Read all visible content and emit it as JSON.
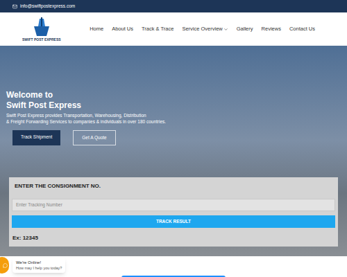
{
  "top_bar": {
    "email": "info@swiftpostexpress.com"
  },
  "logo": {
    "text": "SWIFT POST EXPRESS"
  },
  "nav": [
    {
      "label": "Home",
      "has_menu": false
    },
    {
      "label": "About Us",
      "has_menu": false
    },
    {
      "label": "Track & Trace",
      "has_menu": false
    },
    {
      "label": "Service Overview",
      "has_menu": true
    },
    {
      "label": "Gallery",
      "has_menu": false
    },
    {
      "label": "Reviews",
      "has_menu": false
    },
    {
      "label": "Contact Us",
      "has_menu": false
    }
  ],
  "hero": {
    "title_lines": [
      "Welcome to",
      "Swift Post Express"
    ],
    "text_lines": [
      "Swift Post Express provides Transportation, Warehousing, Distribution",
      "& Freight Forwarding Services to companies & individuals in over 180 countries."
    ],
    "buttons": [
      {
        "label": "Track Shipment",
        "kind": "filled"
      },
      {
        "label": "Get A Quote",
        "kind": "outline"
      }
    ]
  },
  "tracking": {
    "heading": "ENTER THE CONSIGNMENT NO.",
    "placeholder": "Enter Tracking Number",
    "button": "TRACK RESULT",
    "example": "Ex: 12345"
  },
  "chat": {
    "status": "We're Online!",
    "prompt": "How may I help you today?"
  }
}
